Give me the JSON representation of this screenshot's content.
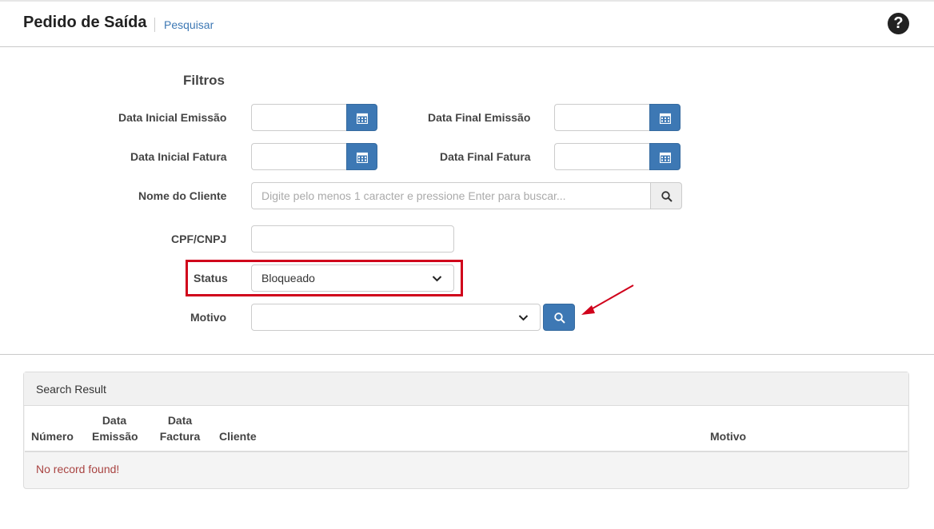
{
  "header": {
    "title": "Pedido de Saída",
    "breadcrumb": "Pesquisar",
    "help_icon": "question-circle-icon"
  },
  "filters": {
    "title": "Filtros",
    "data_inicial_emissao": {
      "label": "Data Inicial Emissão",
      "value": ""
    },
    "data_final_emissao": {
      "label": "Data Final Emissão",
      "value": ""
    },
    "data_inicial_fatura": {
      "label": "Data Inicial Fatura",
      "value": ""
    },
    "data_final_fatura": {
      "label": "Data Final Fatura",
      "value": ""
    },
    "nome_cliente": {
      "label": "Nome do Cliente",
      "placeholder": "Digite pelo menos 1 caracter e pressione Enter para buscar...",
      "value": ""
    },
    "cpf_cnpj": {
      "label": "CPF/CNPJ",
      "value": ""
    },
    "status": {
      "label": "Status",
      "selected": "Bloqueado"
    },
    "motivo": {
      "label": "Motivo",
      "selected": ""
    }
  },
  "colors": {
    "accent": "#3d78b4",
    "highlight": "#d0021b",
    "error_text": "#a94442"
  },
  "results": {
    "title": "Search Result",
    "columns": {
      "numero": "Número",
      "data_emissao_1": "Data",
      "data_emissao_2": "Emissão",
      "data_factura_1": "Data",
      "data_factura_2": "Factura",
      "cliente": "Cliente",
      "motivo": "Motivo"
    },
    "empty_message": "No record found!"
  }
}
